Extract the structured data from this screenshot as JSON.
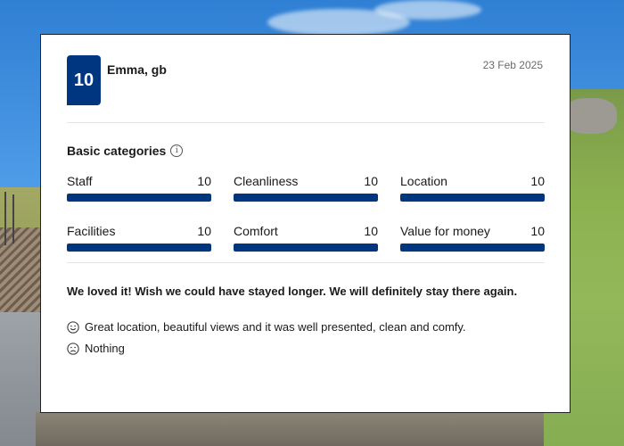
{
  "review": {
    "score": "10",
    "reviewer": "Emma, gb",
    "date": "23 Feb 2025",
    "categories_title": "Basic categories",
    "info_glyph": "i",
    "categories": [
      {
        "label": "Staff",
        "score": "10",
        "fill": 1.0
      },
      {
        "label": "Cleanliness",
        "score": "10",
        "fill": 1.0
      },
      {
        "label": "Location",
        "score": "10",
        "fill": 1.0
      },
      {
        "label": "Facilities",
        "score": "10",
        "fill": 1.0
      },
      {
        "label": "Comfort",
        "score": "10",
        "fill": 1.0
      },
      {
        "label": "Value for money",
        "score": "10",
        "fill": 1.0
      }
    ],
    "headline": "We loved it! Wish we could have stayed longer. We will definitely stay there again.",
    "positive": {
      "icon": "smile-icon",
      "text": "Great location, beautiful views and it was well presented, clean and comfy."
    },
    "negative": {
      "icon": "frown-icon",
      "text": "Nothing"
    }
  },
  "colors": {
    "accent": "#003580",
    "bar_track": "#e6e6e6"
  }
}
